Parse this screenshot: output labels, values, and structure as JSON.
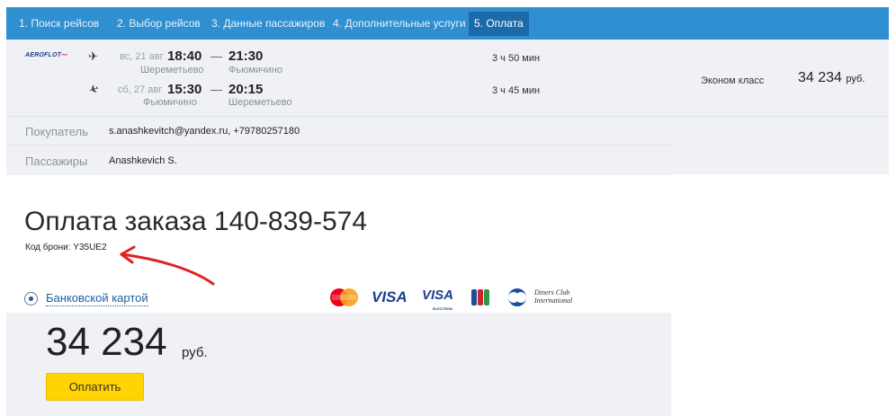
{
  "steps": [
    {
      "label": "1. Поиск рейсов"
    },
    {
      "label": "2. Выбор рейсов"
    },
    {
      "label": "3. Данные пассажиров"
    },
    {
      "label": "4. Дополнительные услуги"
    },
    {
      "label": "5. Оплата"
    }
  ],
  "airline": {
    "logo_text": "AEROFLOT"
  },
  "flights": [
    {
      "direction_icon": "plane-departure-icon",
      "day": "вс, 21 авг",
      "dep_time": "18:40",
      "arr_time": "21:30",
      "dep_airport": "Шереметьево",
      "arr_airport": "Фьюмичино",
      "duration": "3 ч 50 мин"
    },
    {
      "direction_icon": "plane-arrival-icon",
      "day": "сб, 27 авг",
      "dep_time": "15:30",
      "arr_time": "20:15",
      "dep_airport": "Фьюмичино",
      "arr_airport": "Шереметьево",
      "duration": "3 ч 45 мин"
    }
  ],
  "fare": {
    "class": "Эконом класс",
    "price": "34 234",
    "currency": "руб."
  },
  "buyer": {
    "label": "Покупатель",
    "value": "s.anashkevitch@yandex.ru, +79780257180"
  },
  "passengers": {
    "label": "Пассажиры",
    "value": "Anashkevich S."
  },
  "order": {
    "title": "Оплата заказа 140-839-574",
    "booking_code": "Код брони: Y35UE2"
  },
  "payment": {
    "method_label": "Банковской картой",
    "cards": {
      "visa": "VISA",
      "visa_electron": "VISA",
      "electron": "ELECTRON",
      "diners_line1": "Diners Club",
      "diners_line2": "International"
    },
    "amount": "34 234",
    "currency": "руб.",
    "button_label": "Оплатить"
  },
  "colors": {
    "accent": "#2f8fd1",
    "active_step": "#1d6aa8",
    "pay_button": "#ffd400",
    "annotation_arrow": "#e02020"
  }
}
